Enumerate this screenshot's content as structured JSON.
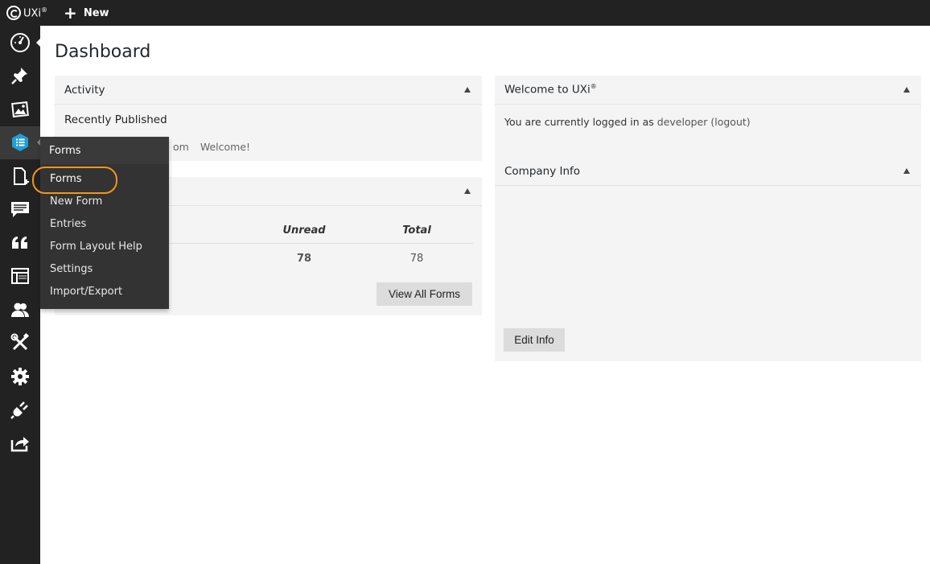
{
  "topbar": {
    "logo_text": "UXi",
    "logo_reg": "®",
    "new_label": "New"
  },
  "sidebar": {
    "items": [
      {
        "icon": "dashboard-icon"
      },
      {
        "icon": "pin-icon"
      },
      {
        "icon": "media-icon"
      },
      {
        "icon": "forms-icon"
      },
      {
        "icon": "page-icon"
      },
      {
        "icon": "comments-icon"
      },
      {
        "icon": "quote-icon"
      },
      {
        "icon": "layout-icon"
      },
      {
        "icon": "users-icon"
      },
      {
        "icon": "tools-icon"
      },
      {
        "icon": "settings-icon"
      },
      {
        "icon": "plugins-icon"
      },
      {
        "icon": "export-icon"
      }
    ]
  },
  "flyout": {
    "title": "Forms",
    "items": [
      "Forms",
      "New Form",
      "Entries",
      "Form Layout Help",
      "Settings",
      "Import/Export"
    ]
  },
  "page": {
    "title": "Dashboard"
  },
  "activity": {
    "title": "Activity",
    "recent_title": "Recently Published",
    "recent_date_fragment": "om",
    "recent_post": "Welcome!"
  },
  "forms_box": {
    "columns": {
      "unread": "Unread",
      "total": "Total"
    },
    "row": {
      "unread": "78",
      "total": "78"
    },
    "button": "View All Forms"
  },
  "welcome": {
    "title": "Welcome to UXi",
    "reg": "®",
    "text_prefix": "You are currently logged in as",
    "user": "developer",
    "logout_open": "(",
    "logout": "logout",
    "logout_close": ")"
  },
  "company": {
    "title": "Company Info",
    "button": "Edit Info"
  },
  "colors": {
    "topbar": "#222222",
    "panel": "#f4f4f4",
    "highlight": "#f7941d",
    "forms_accent": "#1e9fd4"
  }
}
